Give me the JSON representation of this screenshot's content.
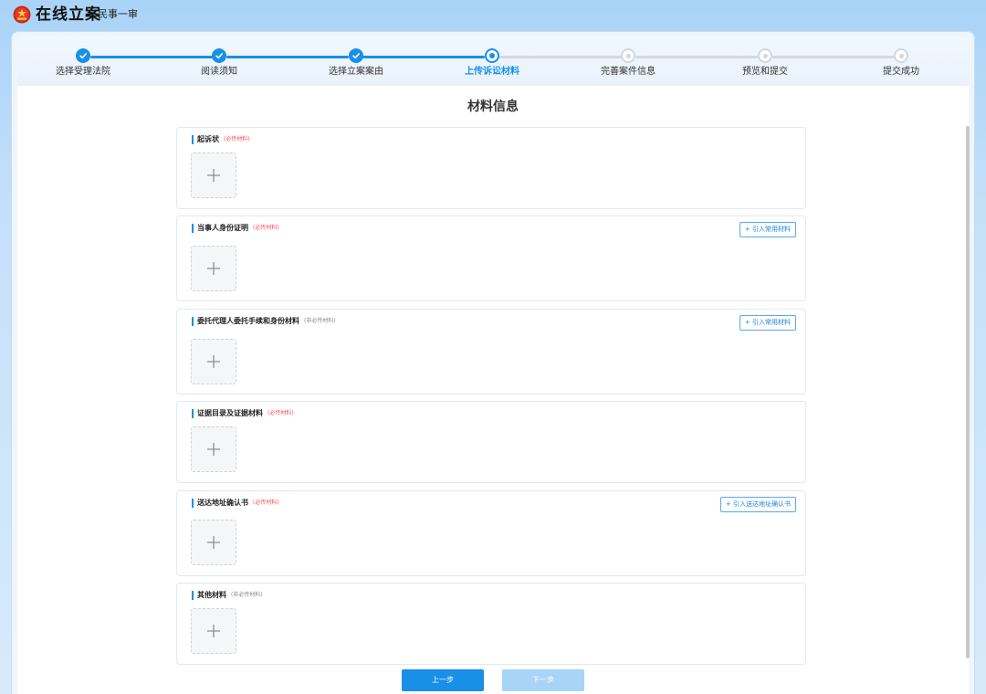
{
  "app": {
    "title": "在线立案",
    "subtitle": "民事一审"
  },
  "steps": [
    {
      "label": "选择受理法院",
      "status": "done"
    },
    {
      "label": "阅读须知",
      "status": "done"
    },
    {
      "label": "选择立案案由",
      "status": "done"
    },
    {
      "label": "上传诉讼材料",
      "status": "active"
    },
    {
      "label": "完善案件信息",
      "status": "todo"
    },
    {
      "label": "预览和提交",
      "status": "todo"
    },
    {
      "label": "提交成功",
      "status": "todo"
    }
  ],
  "page": {
    "title": "材料信息"
  },
  "sections": [
    {
      "name": "起诉状",
      "tag": "(必传材料)",
      "required": true
    },
    {
      "name": "当事人身份证明",
      "tag": "(必传材料)",
      "required": true,
      "import_label": "+ 引入常用材料"
    },
    {
      "name": "委托代理人委托手续和身份材料",
      "tag": "(非必传材料)",
      "required": false,
      "import_label": "+ 引入常用材料"
    },
    {
      "name": "证据目录及证据材料",
      "tag": "(必传材料)",
      "required": true
    },
    {
      "name": "送达地址确认书",
      "tag": "(必传材料)",
      "required": true,
      "import_label": "+ 引入送达地址确认书"
    },
    {
      "name": "其他材料",
      "tag": "(非必传材料)",
      "required": false
    }
  ],
  "footer": {
    "prev_label": "上一步",
    "next_label": "下一步"
  },
  "colors": {
    "primary": "#1890e8",
    "required_tag": "#ff4d4f",
    "next_disabled": "#a8d4f7"
  }
}
